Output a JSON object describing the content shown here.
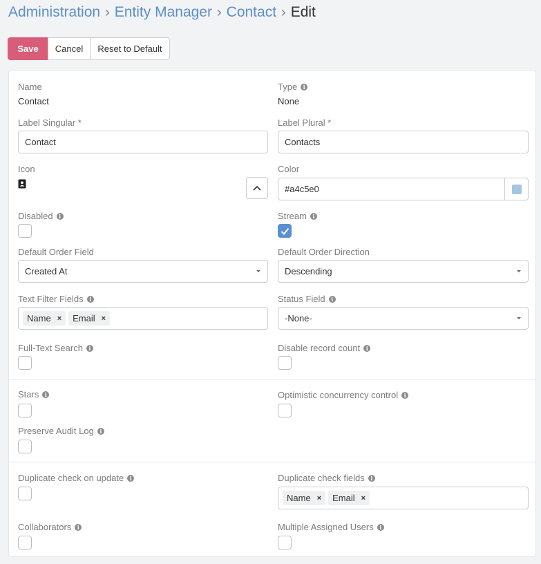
{
  "breadcrumb": {
    "items": [
      "Administration",
      "Entity Manager",
      "Contact"
    ],
    "current": "Edit"
  },
  "toolbar": {
    "save_label": "Save",
    "cancel_label": "Cancel",
    "reset_label": "Reset to Default"
  },
  "form": {
    "name": {
      "label": "Name",
      "value": "Contact"
    },
    "type": {
      "label": "Type",
      "value": "None"
    },
    "label_singular": {
      "label": "Label Singular *",
      "value": "Contact"
    },
    "label_plural": {
      "label": "Label Plural *",
      "value": "Contacts"
    },
    "icon": {
      "label": "Icon",
      "icon_name": "contact-card-icon"
    },
    "color": {
      "label": "Color",
      "value": "#a4c5e0"
    },
    "disabled": {
      "label": "Disabled",
      "checked": false
    },
    "stream": {
      "label": "Stream",
      "checked": true
    },
    "default_order_field": {
      "label": "Default Order Field",
      "value": "Created At"
    },
    "default_order_direction": {
      "label": "Default Order Direction",
      "value": "Descending"
    },
    "text_filter_fields": {
      "label": "Text Filter Fields",
      "tags": [
        "Name",
        "Email"
      ]
    },
    "status_field": {
      "label": "Status Field",
      "value": "-None-"
    },
    "full_text_search": {
      "label": "Full-Text Search",
      "checked": false
    },
    "disable_record_count": {
      "label": "Disable record count",
      "checked": false
    },
    "stars": {
      "label": "Stars",
      "checked": false
    },
    "optimistic_concurrency": {
      "label": "Optimistic concurrency control",
      "checked": false
    },
    "preserve_audit_log": {
      "label": "Preserve Audit Log",
      "checked": false
    },
    "duplicate_check_on_update": {
      "label": "Duplicate check on update",
      "checked": false
    },
    "duplicate_check_fields": {
      "label": "Duplicate check fields",
      "tags": [
        "Name",
        "Email"
      ]
    },
    "collaborators": {
      "label": "Collaborators",
      "checked": false
    },
    "multiple_assigned_users": {
      "label": "Multiple Assigned Users",
      "checked": false
    }
  },
  "colors": {
    "accent": "#5b8fc9",
    "save_button": "#d95d78",
    "checkbox_checked": "#5a8fd1",
    "color_swatch": "#a4c5e0"
  }
}
